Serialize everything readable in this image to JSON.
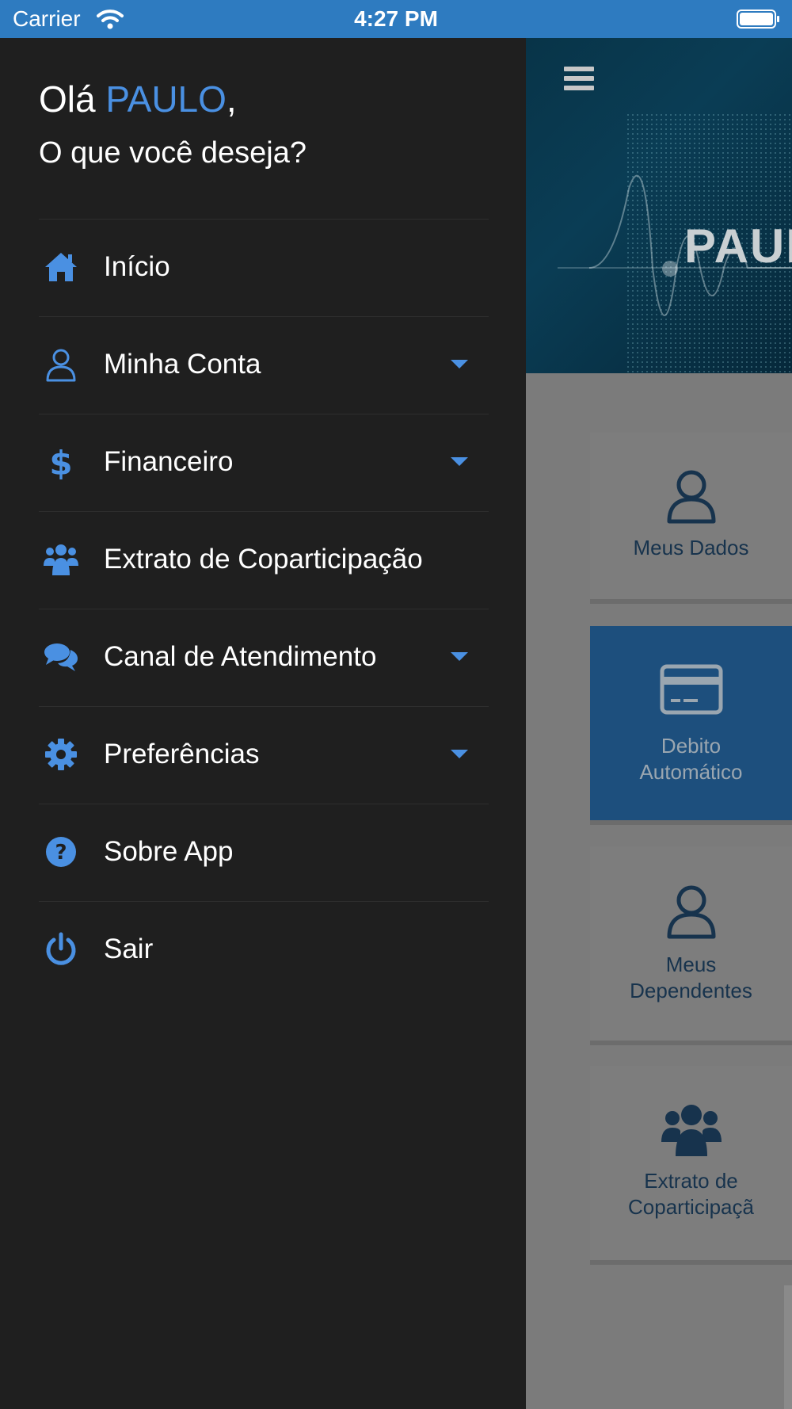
{
  "status_bar": {
    "carrier": "Carrier",
    "time": "4:27 PM",
    "background": "#2e7bc0"
  },
  "drawer": {
    "greeting_prefix": "Olá",
    "user_name": "PAULO",
    "greeting_suffix": ",",
    "subtitle": "O que você deseja?",
    "accent_color": "#4a90e2",
    "items": [
      {
        "label": "Início",
        "icon": "home-icon",
        "expandable": false
      },
      {
        "label": "Minha Conta",
        "icon": "user-icon",
        "expandable": true
      },
      {
        "label": "Financeiro",
        "icon": "dollar-icon",
        "expandable": true
      },
      {
        "label": "Extrato de Coparticipação",
        "icon": "users-icon",
        "expandable": false
      },
      {
        "label": "Canal de Atendimento",
        "icon": "comments-icon",
        "expandable": true
      },
      {
        "label": "Preferências",
        "icon": "gear-icon",
        "expandable": true
      },
      {
        "label": "Sobre App",
        "icon": "question-circle-icon",
        "expandable": false
      },
      {
        "label": "Sair",
        "icon": "power-icon",
        "expandable": false
      }
    ]
  },
  "main": {
    "banner_name": "PAUL",
    "tiles": [
      {
        "label": "Meus Dados",
        "icon": "user-icon"
      },
      {
        "label": "Debito\nAutomático",
        "icon": "credit-card-icon"
      },
      {
        "label": "Meus\nDependentes",
        "icon": "user-icon"
      },
      {
        "label": "Extrato de\nCoparticipaçã",
        "icon": "users-icon"
      }
    ]
  }
}
